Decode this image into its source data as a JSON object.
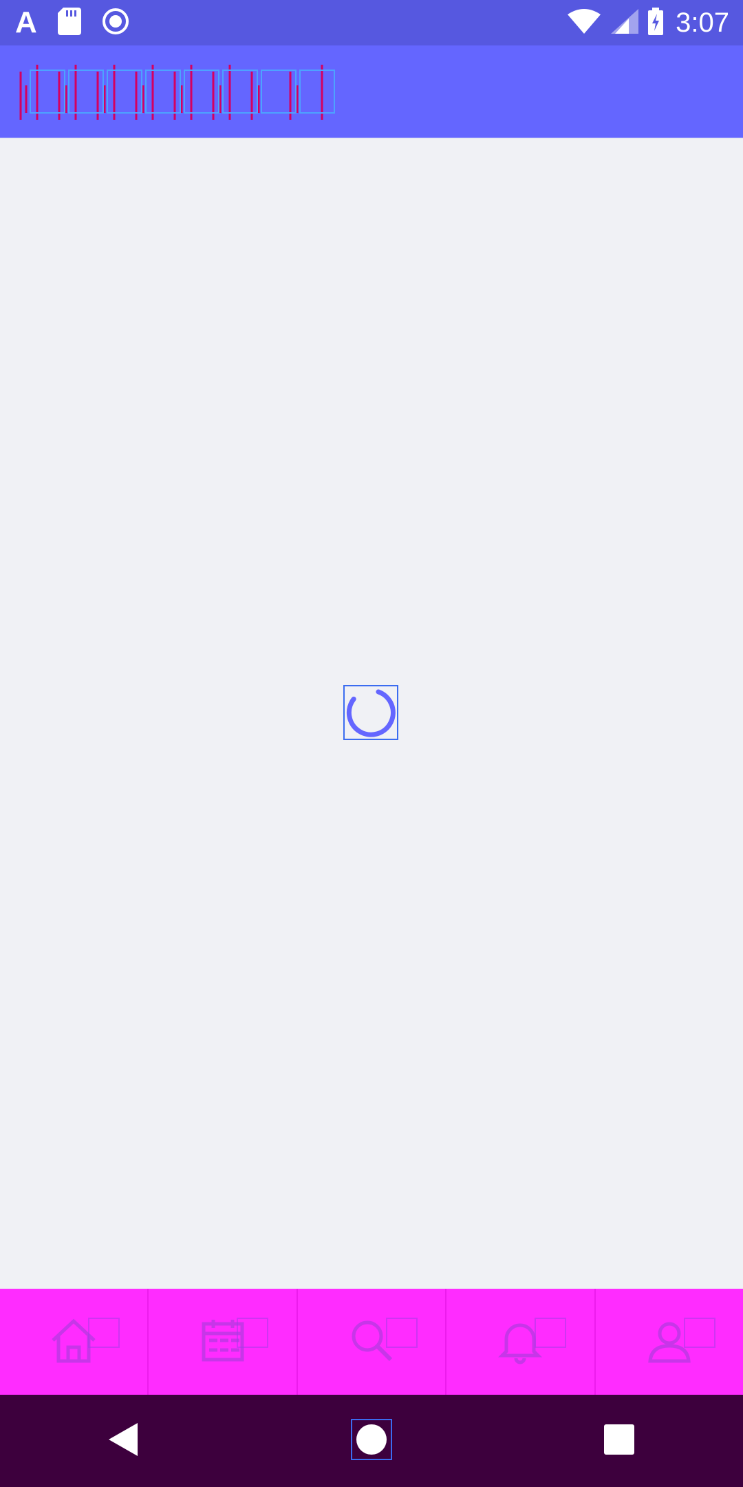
{
  "status_bar": {
    "app_letter": "A",
    "time": "3:07",
    "icons": [
      "sd-card-icon",
      "record-icon",
      "wifi-icon",
      "cell-signal-icon",
      "battery-charging-icon"
    ]
  },
  "toolbar": {
    "background": "#6466ff",
    "title_icon": "glitched-title-icon"
  },
  "content": {
    "state": "loading",
    "spinner_color": "#6466ff"
  },
  "bottom_nav": {
    "background": "#ff2cff",
    "items": [
      {
        "icon": "home-icon"
      },
      {
        "icon": "calendar-icon"
      },
      {
        "icon": "search-icon"
      },
      {
        "icon": "bell-icon"
      },
      {
        "icon": "profile-icon"
      }
    ]
  },
  "system_nav": {
    "buttons": [
      "back-icon",
      "home-circle-icon",
      "recents-icon"
    ]
  }
}
